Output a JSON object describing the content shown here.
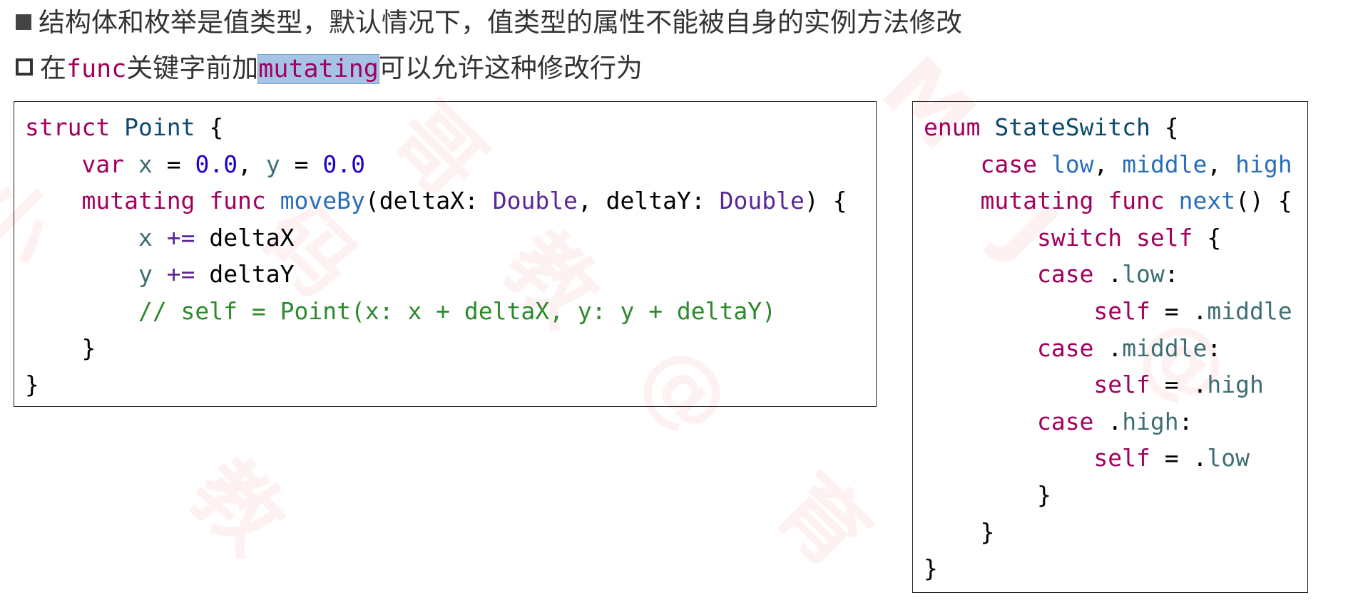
{
  "bullets": {
    "line1": {
      "text": "结构体和枚举是值类型，默认情况下，值类型的属性不能被自身的实例方法修改"
    },
    "line2": {
      "prefix": "在",
      "code1": "func",
      "mid": "关键字前加",
      "code2": "mutating",
      "suffix": "可以允许这种修改行为"
    }
  },
  "left_code": {
    "l1": {
      "kw": "struct",
      "name": "Point",
      "brace": "{"
    },
    "l2": {
      "kw": "var",
      "x": "x",
      "eq1": "=",
      "v1": "0.0",
      "comma": ",",
      "y": "y",
      "eq2": "=",
      "v2": "0.0"
    },
    "l3": {
      "kw1": "mutating",
      "kw2": "func",
      "fn": "moveBy",
      "p1": "(deltaX:",
      "t1": "Double",
      "p2": ", deltaY:",
      "t2": "Double",
      "end": ") {"
    },
    "l4": {
      "v": "x",
      "op": "+=",
      "rhs": "deltaX"
    },
    "l5": {
      "v": "y",
      "op": "+=",
      "rhs": "deltaY"
    },
    "l6": {
      "comment": "// self = Point(x: x + deltaX, y: y + deltaY)"
    },
    "l7": {
      "brace": "}"
    },
    "l8": {
      "brace": "}"
    }
  },
  "right_code": {
    "l1": {
      "kw": "enum",
      "name": "StateSwitch",
      "brace": "{"
    },
    "l2": {
      "kw": "case",
      "c1": "low",
      "sep1": ",",
      "c2": "middle",
      "sep2": ",",
      "c3": "high"
    },
    "l3": {
      "kw1": "mutating",
      "kw2": "func",
      "fn": "next",
      "end": "() {"
    },
    "l4": {
      "kw1": "switch",
      "kw2": "self",
      "brace": "{"
    },
    "l5": {
      "kw": "case",
      "dot": ".",
      "mem": "low",
      "colon": ":"
    },
    "l6": {
      "kw": "self",
      "eq": "=",
      "dot": ".",
      "mem": "middle"
    },
    "l7": {
      "kw": "case",
      "dot": ".",
      "mem": "middle",
      "colon": ":"
    },
    "l8": {
      "kw": "self",
      "eq": "=",
      "dot": ".",
      "mem": "high"
    },
    "l9": {
      "kw": "case",
      "dot": ".",
      "mem": "high",
      "colon": ":"
    },
    "l10": {
      "kw": "self",
      "eq": "=",
      "dot": ".",
      "mem": "low"
    },
    "l11": {
      "brace": "}"
    },
    "l12": {
      "brace": "}"
    },
    "l13": {
      "brace": "}"
    }
  },
  "colors": {
    "keyword": "#a2005e",
    "type_name": "#0c4a6e",
    "type_ref": "#5b2699",
    "number": "#1c00cf",
    "property": "#3f6e74",
    "comment": "#2d8a2d",
    "highlight": "#a5c3e6"
  }
}
